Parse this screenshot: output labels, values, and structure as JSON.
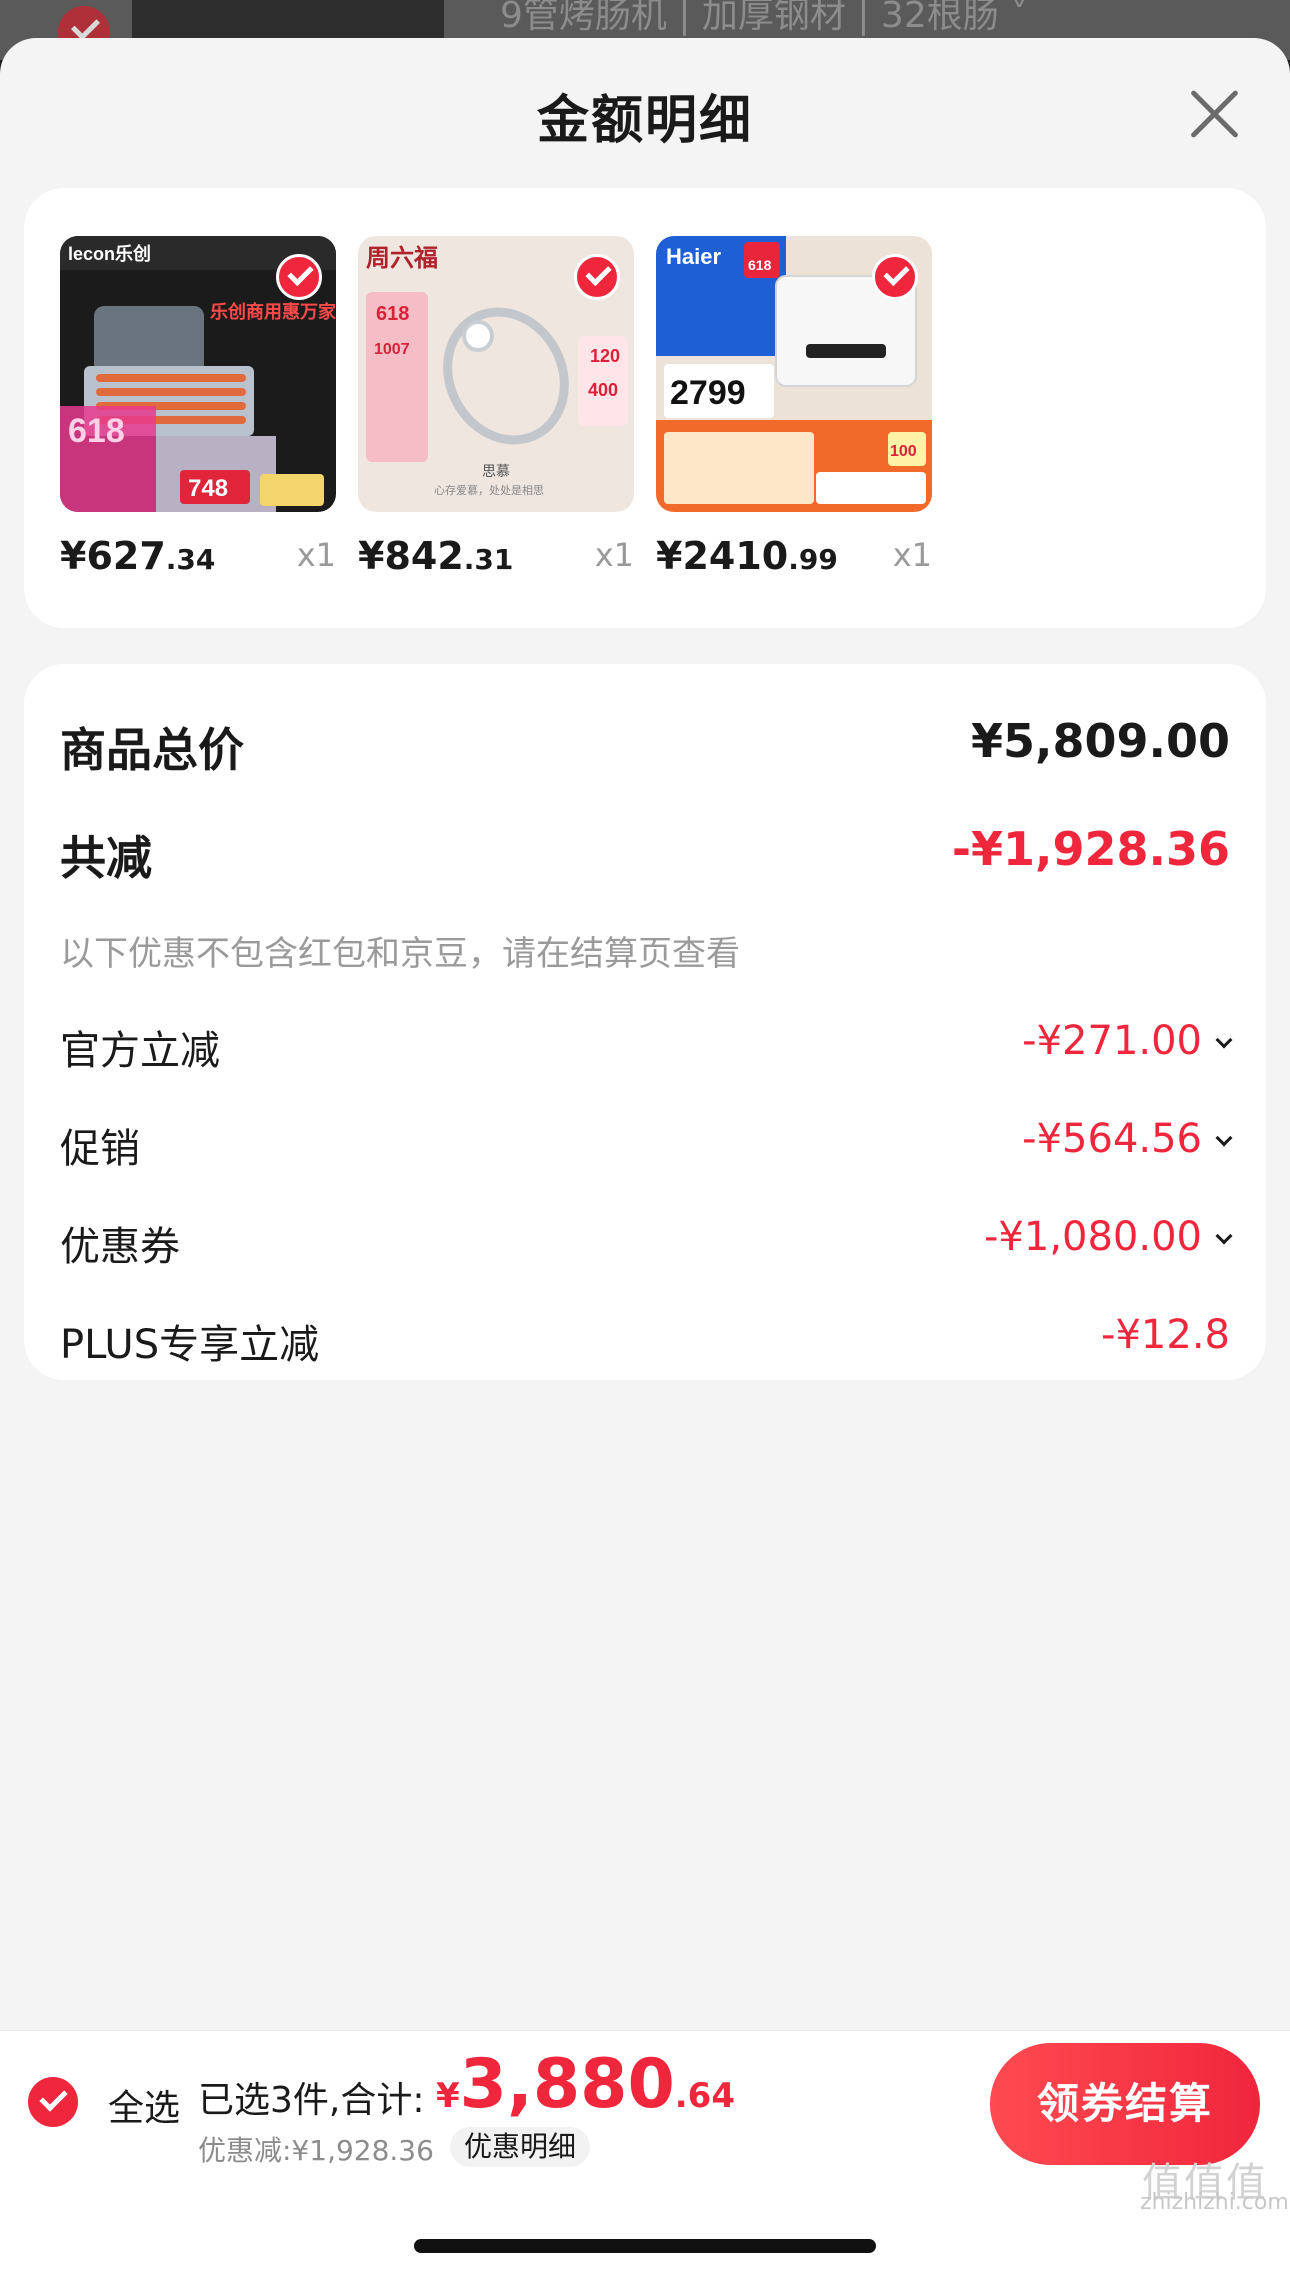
{
  "background": {
    "text": "9管烤肠机 | 加厚钢材 | 32根肠 ˅"
  },
  "sheet": {
    "title": "金额明细"
  },
  "products": [
    {
      "price_int": "¥627",
      "price_dec": ".34",
      "qty": "x1",
      "thumb_logo": "lecon乐创",
      "thumb_badge": "618",
      "thumb_price": "748",
      "thumb_headline": "乐创商用惠万家"
    },
    {
      "price_int": "¥842",
      "price_dec": ".31",
      "qty": "x1",
      "thumb_logo": "周六福",
      "thumb_badge": "618",
      "thumb_price": "1007",
      "thumb_caption": "思慕",
      "thumb_sub": "心存爱慕，处处是相思"
    },
    {
      "price_int": "¥2410",
      "price_dec": ".99",
      "qty": "x1",
      "thumb_logo": "Haier",
      "thumb_badge": "618",
      "thumb_price": "2799",
      "thumb_extra": "100"
    }
  ],
  "breakdown": {
    "total_label": "商品总价",
    "total_value": "¥5,809.00",
    "reduce_label": "共减",
    "reduce_value": "-¥1,928.36",
    "note": "以下优惠不包含红包和京豆，请在结算页查看",
    "items": [
      {
        "label": "官方立减",
        "value": "-¥271.00"
      },
      {
        "label": "促销",
        "value": "-¥564.56"
      },
      {
        "label": "优惠券",
        "value": "-¥1,080.00"
      },
      {
        "label": "PLUS专享立减",
        "value": "-¥12.8"
      }
    ]
  },
  "bottom_bar": {
    "select_all": "全选",
    "summary": "已选3件,合计:",
    "currency": "¥",
    "total_int": "3,880",
    "total_dec": ".64",
    "discount": "优惠减:¥1,928.36",
    "detail_link": "优惠明细",
    "checkout": "领券结算"
  },
  "watermark": {
    "logo": "值值值",
    "url": "zhizhizhi.com"
  },
  "colors": {
    "accent": "#f0263c",
    "sheet_bg": "#f4f4f4",
    "card_bg": "#ffffff"
  }
}
